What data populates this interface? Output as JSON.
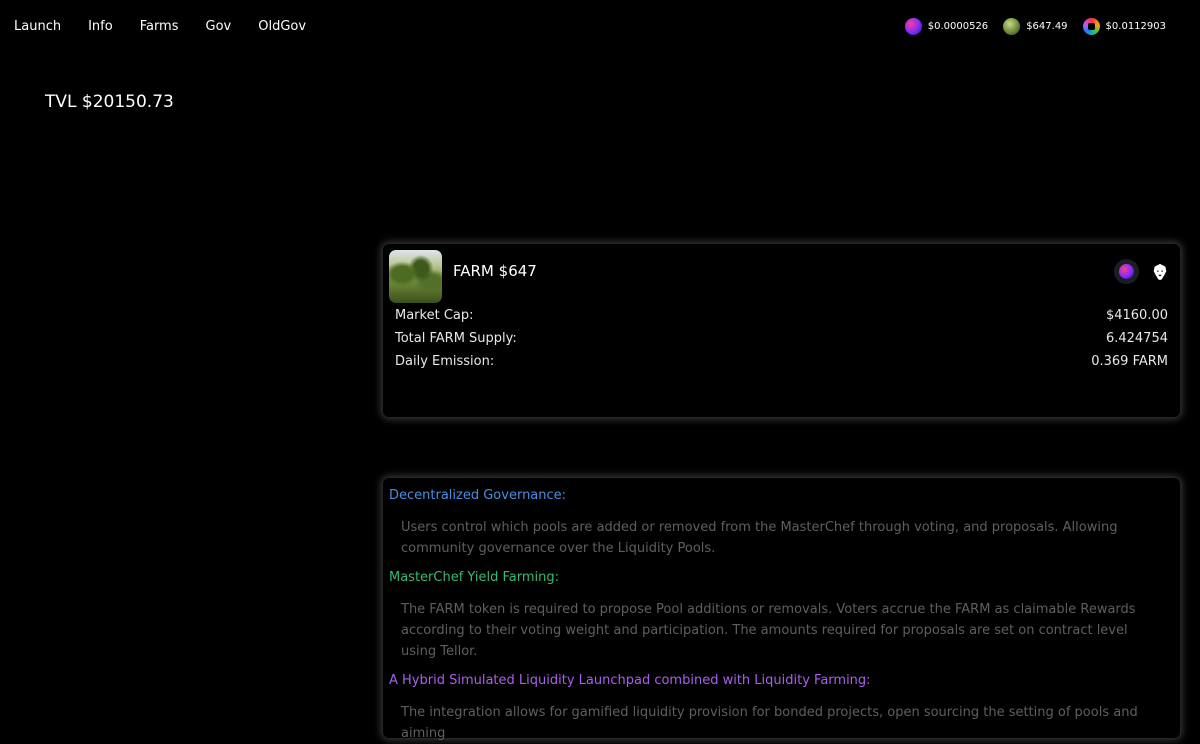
{
  "nav": {
    "links": [
      "Launch",
      "Info",
      "Farms",
      "Gov",
      "OldGov"
    ]
  },
  "prices": [
    {
      "icon": "pulse-coin-icon",
      "value": "$0.0000526"
    },
    {
      "icon": "farm-coin-icon",
      "value": "$647.49"
    },
    {
      "icon": "hex-coin-icon",
      "value": "$0.0112903"
    }
  ],
  "tvl": "TVL $20150.73",
  "farm_card": {
    "title": "FARM $647",
    "stats": [
      {
        "label": "Market Cap:",
        "value": "$4160.00"
      },
      {
        "label": "Total FARM Supply:",
        "value": "6.424754"
      },
      {
        "label": "Daily Emission:",
        "value": "0.369 FARM"
      }
    ]
  },
  "info": {
    "sections": [
      {
        "heading": "Decentralized Governance:",
        "color": "#4a8fe0",
        "text": "Users control which pools are added or removed from the MasterChef through voting, and proposals. Allowing community governance over the Liquidity Pools."
      },
      {
        "heading": "MasterChef Yield Farming:",
        "color": "#38b873",
        "text": "The FARM token is required to propose Pool additions or removals. Voters accrue the FARM as claimable Rewards according to their voting weight and participation. The amounts required for proposals are set on contract level using Tellor."
      },
      {
        "heading": "A Hybrid Simulated Liquidity Launchpad combined with Liquidity Farming:",
        "color": "#a85ff0",
        "text": "The integration allows for gamified liquidity provision for bonded projects, open sourcing the setting of pools and aiming"
      }
    ]
  }
}
